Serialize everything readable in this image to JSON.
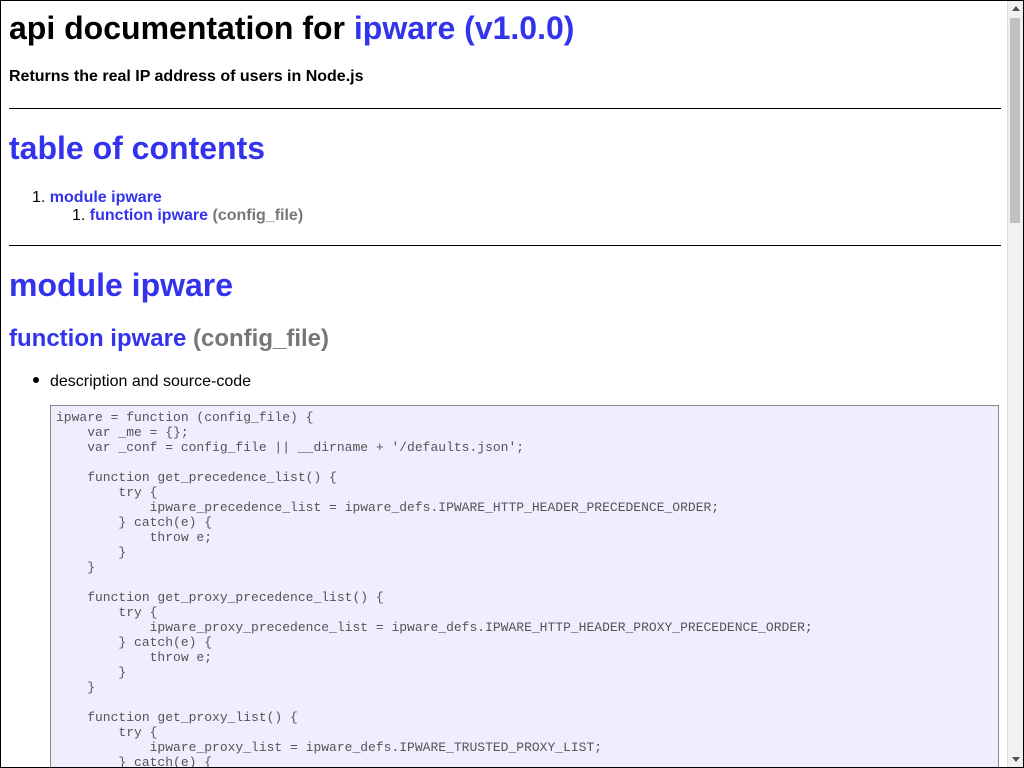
{
  "title": {
    "prefix": "api documentation for ",
    "package_link": "ipware (v1.0.0)"
  },
  "description": "Returns the real IP address of users in Node.js",
  "toc": {
    "heading": "table of contents",
    "items": [
      {
        "number": "1.",
        "label": "module ipware"
      },
      {
        "number": "1.",
        "label": "function ipware",
        "signature": "(config_file)"
      }
    ]
  },
  "module": {
    "heading": "module ipware",
    "function_name": "function ipware",
    "function_signature": "(config_file)",
    "bullet": "description and source-code",
    "source_code": "ipware = function (config_file) {\n    var _me = {};\n    var _conf = config_file || __dirname + '/defaults.json';\n\n    function get_precedence_list() {\n        try {\n            ipware_precedence_list = ipware_defs.IPWARE_HTTP_HEADER_PRECEDENCE_ORDER;\n        } catch(e) {\n            throw e;\n        }\n    }\n\n    function get_proxy_precedence_list() {\n        try {\n            ipware_proxy_precedence_list = ipware_defs.IPWARE_HTTP_HEADER_PROXY_PRECEDENCE_ORDER;\n        } catch(e) {\n            throw e;\n        }\n    }\n\n    function get_proxy_list() {\n        try {\n            ipware_proxy_list = ipware_defs.IPWARE_TRUSTED_PROXY_LIST;\n        } catch(e) {"
  },
  "colors": {
    "link": "#3333ee",
    "muted": "#777777",
    "code_background": "#eeeeff"
  },
  "icons": {
    "scroll_up": "triangle-up-icon",
    "scroll_down": "triangle-down-icon"
  }
}
